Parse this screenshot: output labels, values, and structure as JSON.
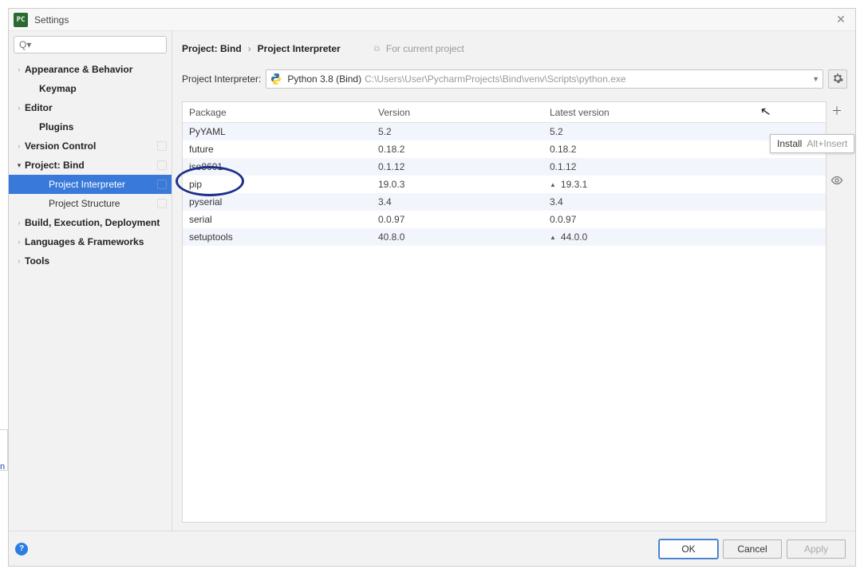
{
  "window": {
    "title": "Settings"
  },
  "search": {
    "placeholder": "Q▾"
  },
  "sidebar": {
    "items": [
      {
        "label": "Appearance & Behavior",
        "bold": true,
        "caret": ">"
      },
      {
        "label": "Keymap",
        "bold": true,
        "child": true
      },
      {
        "label": "Editor",
        "bold": true,
        "caret": ">"
      },
      {
        "label": "Plugins",
        "bold": true,
        "child": true
      },
      {
        "label": "Version Control",
        "bold": true,
        "caret": ">",
        "badge": true
      },
      {
        "label": "Project: Bind",
        "bold": true,
        "caret": "v",
        "badge": true
      },
      {
        "label": "Project Interpreter",
        "child2": true,
        "selected": true,
        "badge": true
      },
      {
        "label": "Project Structure",
        "child2": true,
        "badge": true
      },
      {
        "label": "Build, Execution, Deployment",
        "bold": true,
        "caret": ">"
      },
      {
        "label": "Languages & Frameworks",
        "bold": true,
        "caret": ">"
      },
      {
        "label": "Tools",
        "bold": true,
        "caret": ">"
      }
    ]
  },
  "breadcrumb": {
    "root": "Project: Bind",
    "sep": "›",
    "leaf": "Project Interpreter",
    "hint": "For current project"
  },
  "interpreter": {
    "label": "Project Interpreter:",
    "name": "Python 3.8 (Bind)",
    "path": "C:\\Users\\User\\PycharmProjects\\Bind\\venv\\Scripts\\python.exe"
  },
  "table": {
    "headers": {
      "package": "Package",
      "version": "Version",
      "latest": "Latest version"
    },
    "rows": [
      {
        "package": "PyYAML",
        "version": "5.2",
        "latest": "5.2"
      },
      {
        "package": "future",
        "version": "0.18.2",
        "latest": "0.18.2"
      },
      {
        "package": "iso8601",
        "version": "0.1.12",
        "latest": "0.1.12"
      },
      {
        "package": "pip",
        "version": "19.0.3",
        "latest": "19.3.1",
        "upgrade": true
      },
      {
        "package": "pyserial",
        "version": "3.4",
        "latest": "3.4"
      },
      {
        "package": "serial",
        "version": "0.0.97",
        "latest": "0.0.97"
      },
      {
        "package": "setuptools",
        "version": "40.8.0",
        "latest": "44.0.0",
        "upgrade": true
      }
    ]
  },
  "tooltip": {
    "label": "Install",
    "shortcut": "Alt+Insert"
  },
  "footer": {
    "ok": "OK",
    "cancel": "Cancel",
    "apply": "Apply"
  }
}
